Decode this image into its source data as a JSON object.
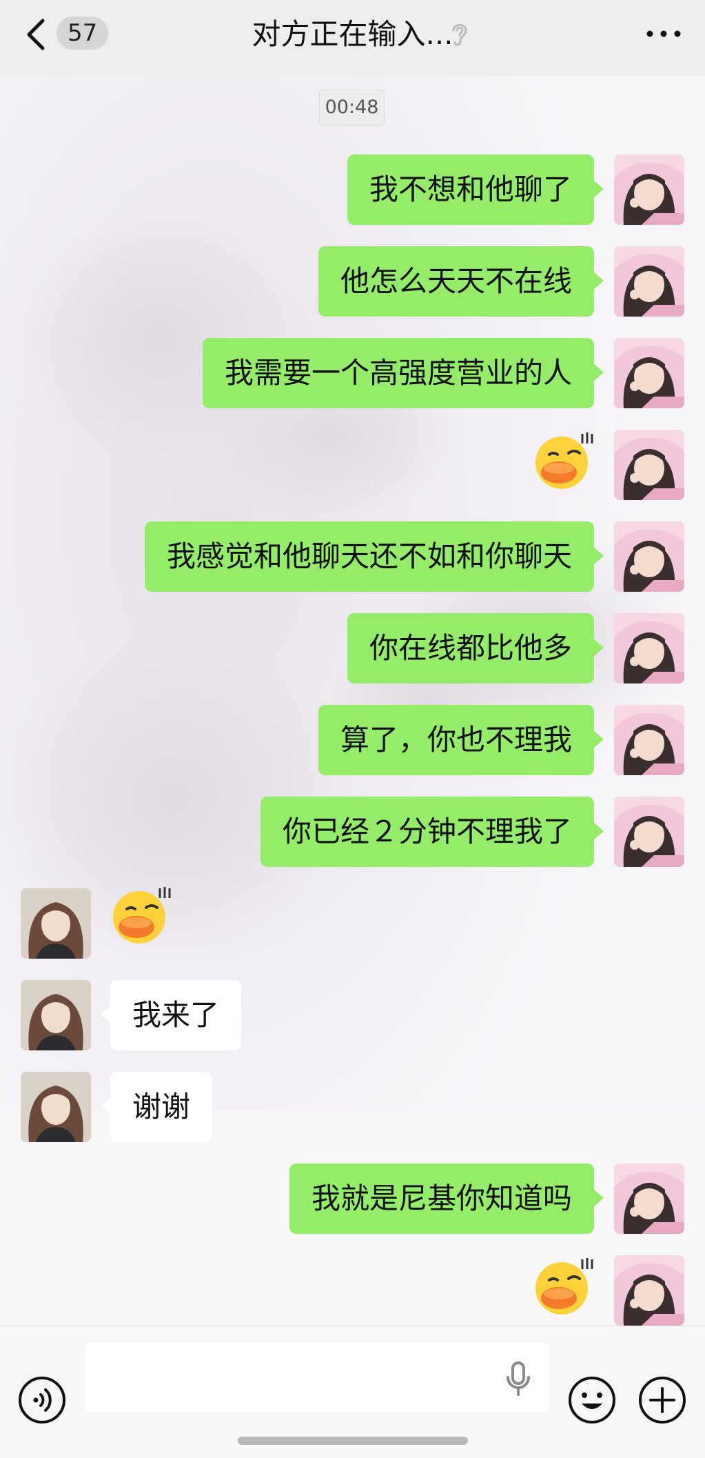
{
  "header": {
    "unread_count": "57",
    "title": "对方正在输入..."
  },
  "chat": {
    "timestamp": "00:48",
    "messages": [
      {
        "from": "me",
        "type": "text",
        "text": "我不想和他聊了"
      },
      {
        "from": "me",
        "type": "text",
        "text": "他怎么天天不在线"
      },
      {
        "from": "me",
        "type": "text",
        "text": "我需要一个高强度营业的人"
      },
      {
        "from": "me",
        "type": "sticker",
        "sticker": "duck-sticker"
      },
      {
        "from": "me",
        "type": "text",
        "text": "我感觉和他聊天还不如和你聊天"
      },
      {
        "from": "me",
        "type": "text",
        "text": "你在线都比他多"
      },
      {
        "from": "me",
        "type": "text",
        "text": "算了，你也不理我"
      },
      {
        "from": "me",
        "type": "text",
        "text": "你已经２分钟不理我了"
      },
      {
        "from": "them",
        "type": "sticker",
        "sticker": "duck-sticker"
      },
      {
        "from": "them",
        "type": "text",
        "text": "我来了"
      },
      {
        "from": "them",
        "type": "text",
        "text": "谢谢"
      },
      {
        "from": "me",
        "type": "text",
        "text": "我就是尼基你知道吗"
      },
      {
        "from": "me",
        "type": "sticker",
        "sticker": "duck-sticker"
      }
    ]
  },
  "input_bar": {
    "value": "",
    "icons": [
      "voice-icon",
      "mic-icon",
      "emoji-icon",
      "plus-icon"
    ]
  },
  "colors": {
    "my_bubble": "#95ec69",
    "their_bubble": "#ffffff",
    "header_bg": "#ededed",
    "chat_bg": "#f5f4f7"
  }
}
